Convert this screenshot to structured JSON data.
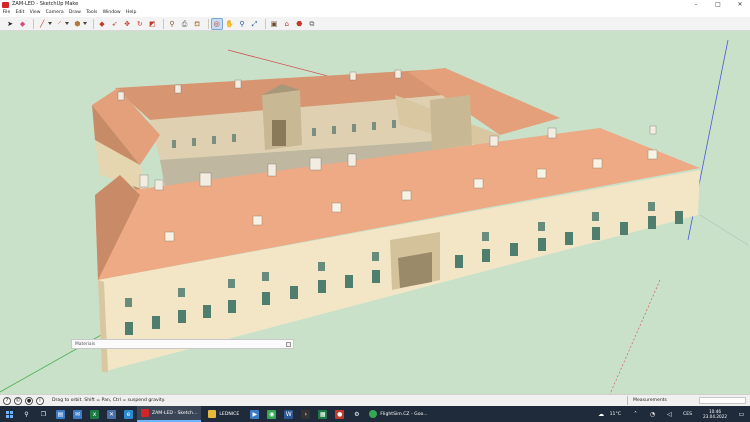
{
  "window": {
    "title": "ZAM-LED - SketchUp Make",
    "controls": {
      "minimize": "–",
      "maximize": "□",
      "close": "✕"
    }
  },
  "menu": [
    "File",
    "Edit",
    "View",
    "Camera",
    "Draw",
    "Tools",
    "Window",
    "Help"
  ],
  "toolbar": {
    "tools": [
      {
        "name": "select-tool",
        "glyph": "➤",
        "color": "#222222"
      },
      {
        "name": "eraser-tool",
        "glyph": "◆",
        "color": "#d84a7a"
      },
      {
        "name": "line-tool",
        "glyph": "╱",
        "color": "#c0392b",
        "dropdown": true
      },
      {
        "name": "arc-tool",
        "glyph": "◜",
        "color": "#c0392b",
        "dropdown": true
      },
      {
        "name": "shape-tool",
        "glyph": "⬢",
        "color": "#b07a3a",
        "dropdown": true
      },
      {
        "name": "push-pull-tool",
        "glyph": "◆",
        "color": "#c0392b"
      },
      {
        "name": "offset-tool",
        "glyph": "➶",
        "color": "#c0392b"
      },
      {
        "name": "move-tool",
        "glyph": "✥",
        "color": "#c0392b"
      },
      {
        "name": "rotate-tool",
        "glyph": "↻",
        "color": "#c0392b"
      },
      {
        "name": "scale-tool",
        "glyph": "◩",
        "color": "#c0392b"
      },
      {
        "name": "tape-measure-tool",
        "glyph": "⚲",
        "color": "#7a5a2a"
      },
      {
        "name": "text-tool",
        "glyph": "⎙",
        "color": "#555555"
      },
      {
        "name": "paint-bucket-tool",
        "glyph": "⛾",
        "color": "#b07a3a"
      },
      {
        "name": "orbit-tool",
        "glyph": "◎",
        "color": "#c0392b",
        "active": true
      },
      {
        "name": "pan-tool",
        "glyph": "✋",
        "color": "#2a5a9a"
      },
      {
        "name": "zoom-tool",
        "glyph": "⚲",
        "color": "#2a5a9a"
      },
      {
        "name": "zoom-extents-tool",
        "glyph": "⤢",
        "color": "#2a5a9a"
      },
      {
        "name": "components-tool",
        "glyph": "▣",
        "color": "#6a4a2a"
      },
      {
        "name": "warehouse-tool",
        "glyph": "⌂",
        "color": "#c0392b"
      },
      {
        "name": "extension-warehouse-tool",
        "glyph": "⬣",
        "color": "#c0392b"
      },
      {
        "name": "share-model-tool",
        "glyph": "⧉",
        "color": "#666666"
      }
    ]
  },
  "materials": {
    "label": "Materials"
  },
  "status": {
    "hint": "Drag to orbit. Shift = Pan, Ctrl = suspend gravity.",
    "measurements_label": "Measurements"
  },
  "taskbar": {
    "apps": [
      {
        "name": "sketchup",
        "label": "ZAM-LED - Sketch...",
        "color": "#d3242a",
        "active": true
      },
      {
        "name": "explorer",
        "label": "LEDNICE",
        "color": "#e8b83a",
        "active": false
      },
      {
        "name": "chrome",
        "label": "FlightSim.CZ - Goo...",
        "color": "#34a853",
        "active": false
      }
    ],
    "weather": "11°C",
    "language": "CES",
    "time": "10:46",
    "date": "23.04.2022"
  },
  "colors": {
    "sky": "#c9e1c9",
    "roof": "#e8a37d",
    "roof_shadow": "#c98a68",
    "wall": "#f3e6c6",
    "wall_shadow": "#d8c7a0",
    "accent": "#6fb4ff"
  }
}
